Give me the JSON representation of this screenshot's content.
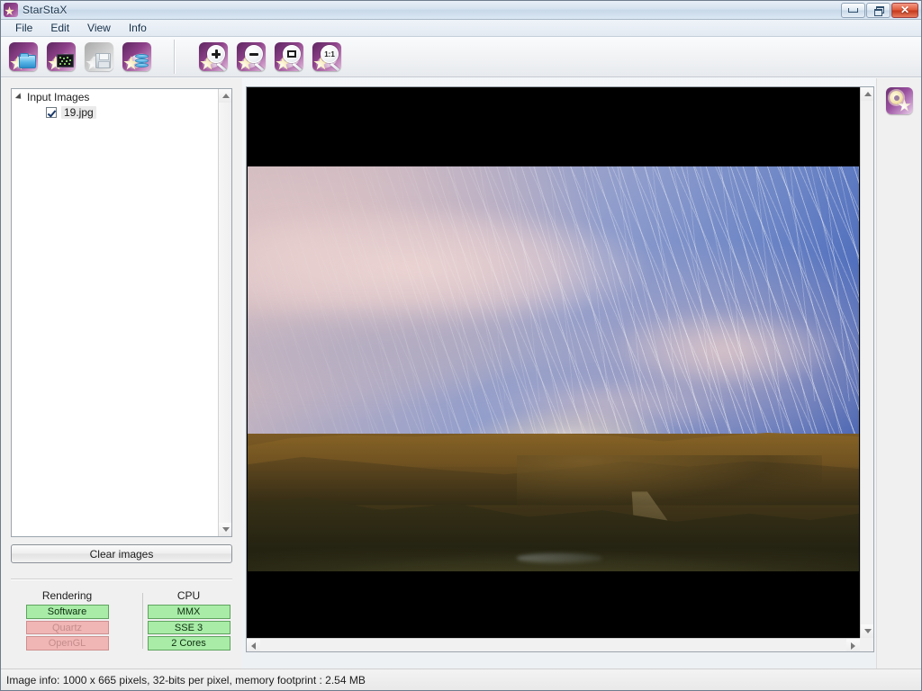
{
  "window": {
    "title": "StarStaX",
    "app_icon": "starstax-logo-icon",
    "controls": {
      "minimize": "minimize-icon",
      "restore": "restore-icon",
      "close": "close-icon"
    }
  },
  "menubar": {
    "items": [
      {
        "label": "File"
      },
      {
        "label": "Edit"
      },
      {
        "label": "View"
      },
      {
        "label": "Info"
      }
    ]
  },
  "toolbar": {
    "groups": [
      {
        "buttons": [
          {
            "icon": "open-images-icon",
            "label": "Open Images",
            "enabled": true
          },
          {
            "icon": "start-processing-icon",
            "label": "Start Processing",
            "enabled": true
          },
          {
            "icon": "save-image-icon",
            "label": "Save Image",
            "enabled": false
          },
          {
            "icon": "save-as-icon",
            "label": "Save Image As",
            "enabled": true
          }
        ]
      },
      {
        "buttons": [
          {
            "icon": "zoom-in-icon",
            "label": "Zoom In",
            "enabled": true
          },
          {
            "icon": "zoom-out-icon",
            "label": "Zoom Out",
            "enabled": true
          },
          {
            "icon": "fit-to-window-icon",
            "label": "Fit To Window",
            "enabled": true
          },
          {
            "icon": "actual-size-icon",
            "label": "1:1",
            "enabled": true
          }
        ]
      }
    ]
  },
  "sidebar": {
    "tree": {
      "root_label": "Input Images",
      "expanded": true,
      "children": [
        {
          "label": "19.jpg",
          "checked": true
        }
      ]
    },
    "clear_button_label": "Clear images",
    "capabilities": {
      "rendering": {
        "title": "Rendering",
        "items": [
          {
            "label": "Software",
            "state": "on"
          },
          {
            "label": "Quartz",
            "state": "off"
          },
          {
            "label": "OpenGL",
            "state": "off"
          }
        ]
      },
      "cpu": {
        "title": "CPU",
        "items": [
          {
            "label": "MMX",
            "state": "on"
          },
          {
            "label": "SSE 3",
            "state": "on"
          },
          {
            "label": "2 Cores",
            "state": "on"
          }
        ]
      }
    }
  },
  "viewer": {
    "image_name": "19.jpg",
    "description": "Star trail night-sky photograph over rolling golden hills with a valley path",
    "background_color": "#000000",
    "scrollbars": {
      "vertical": "vertical-scrollbar",
      "horizontal": "horizontal-scrollbar"
    }
  },
  "right_panel": {
    "settings_button": {
      "icon": "settings-gear-icon",
      "label": "Preferences"
    }
  },
  "statusbar": {
    "text": "Image info: 1000 x 665 pixels, 32-bits per pixel, memory footprint :  2.54 MB"
  },
  "colors": {
    "accent_purple": "#8e4189",
    "chip_on": "#a8eca8",
    "chip_off": "#f0b6b6",
    "titlebar": "#d5e2ef",
    "close_red": "#c53a1c"
  }
}
